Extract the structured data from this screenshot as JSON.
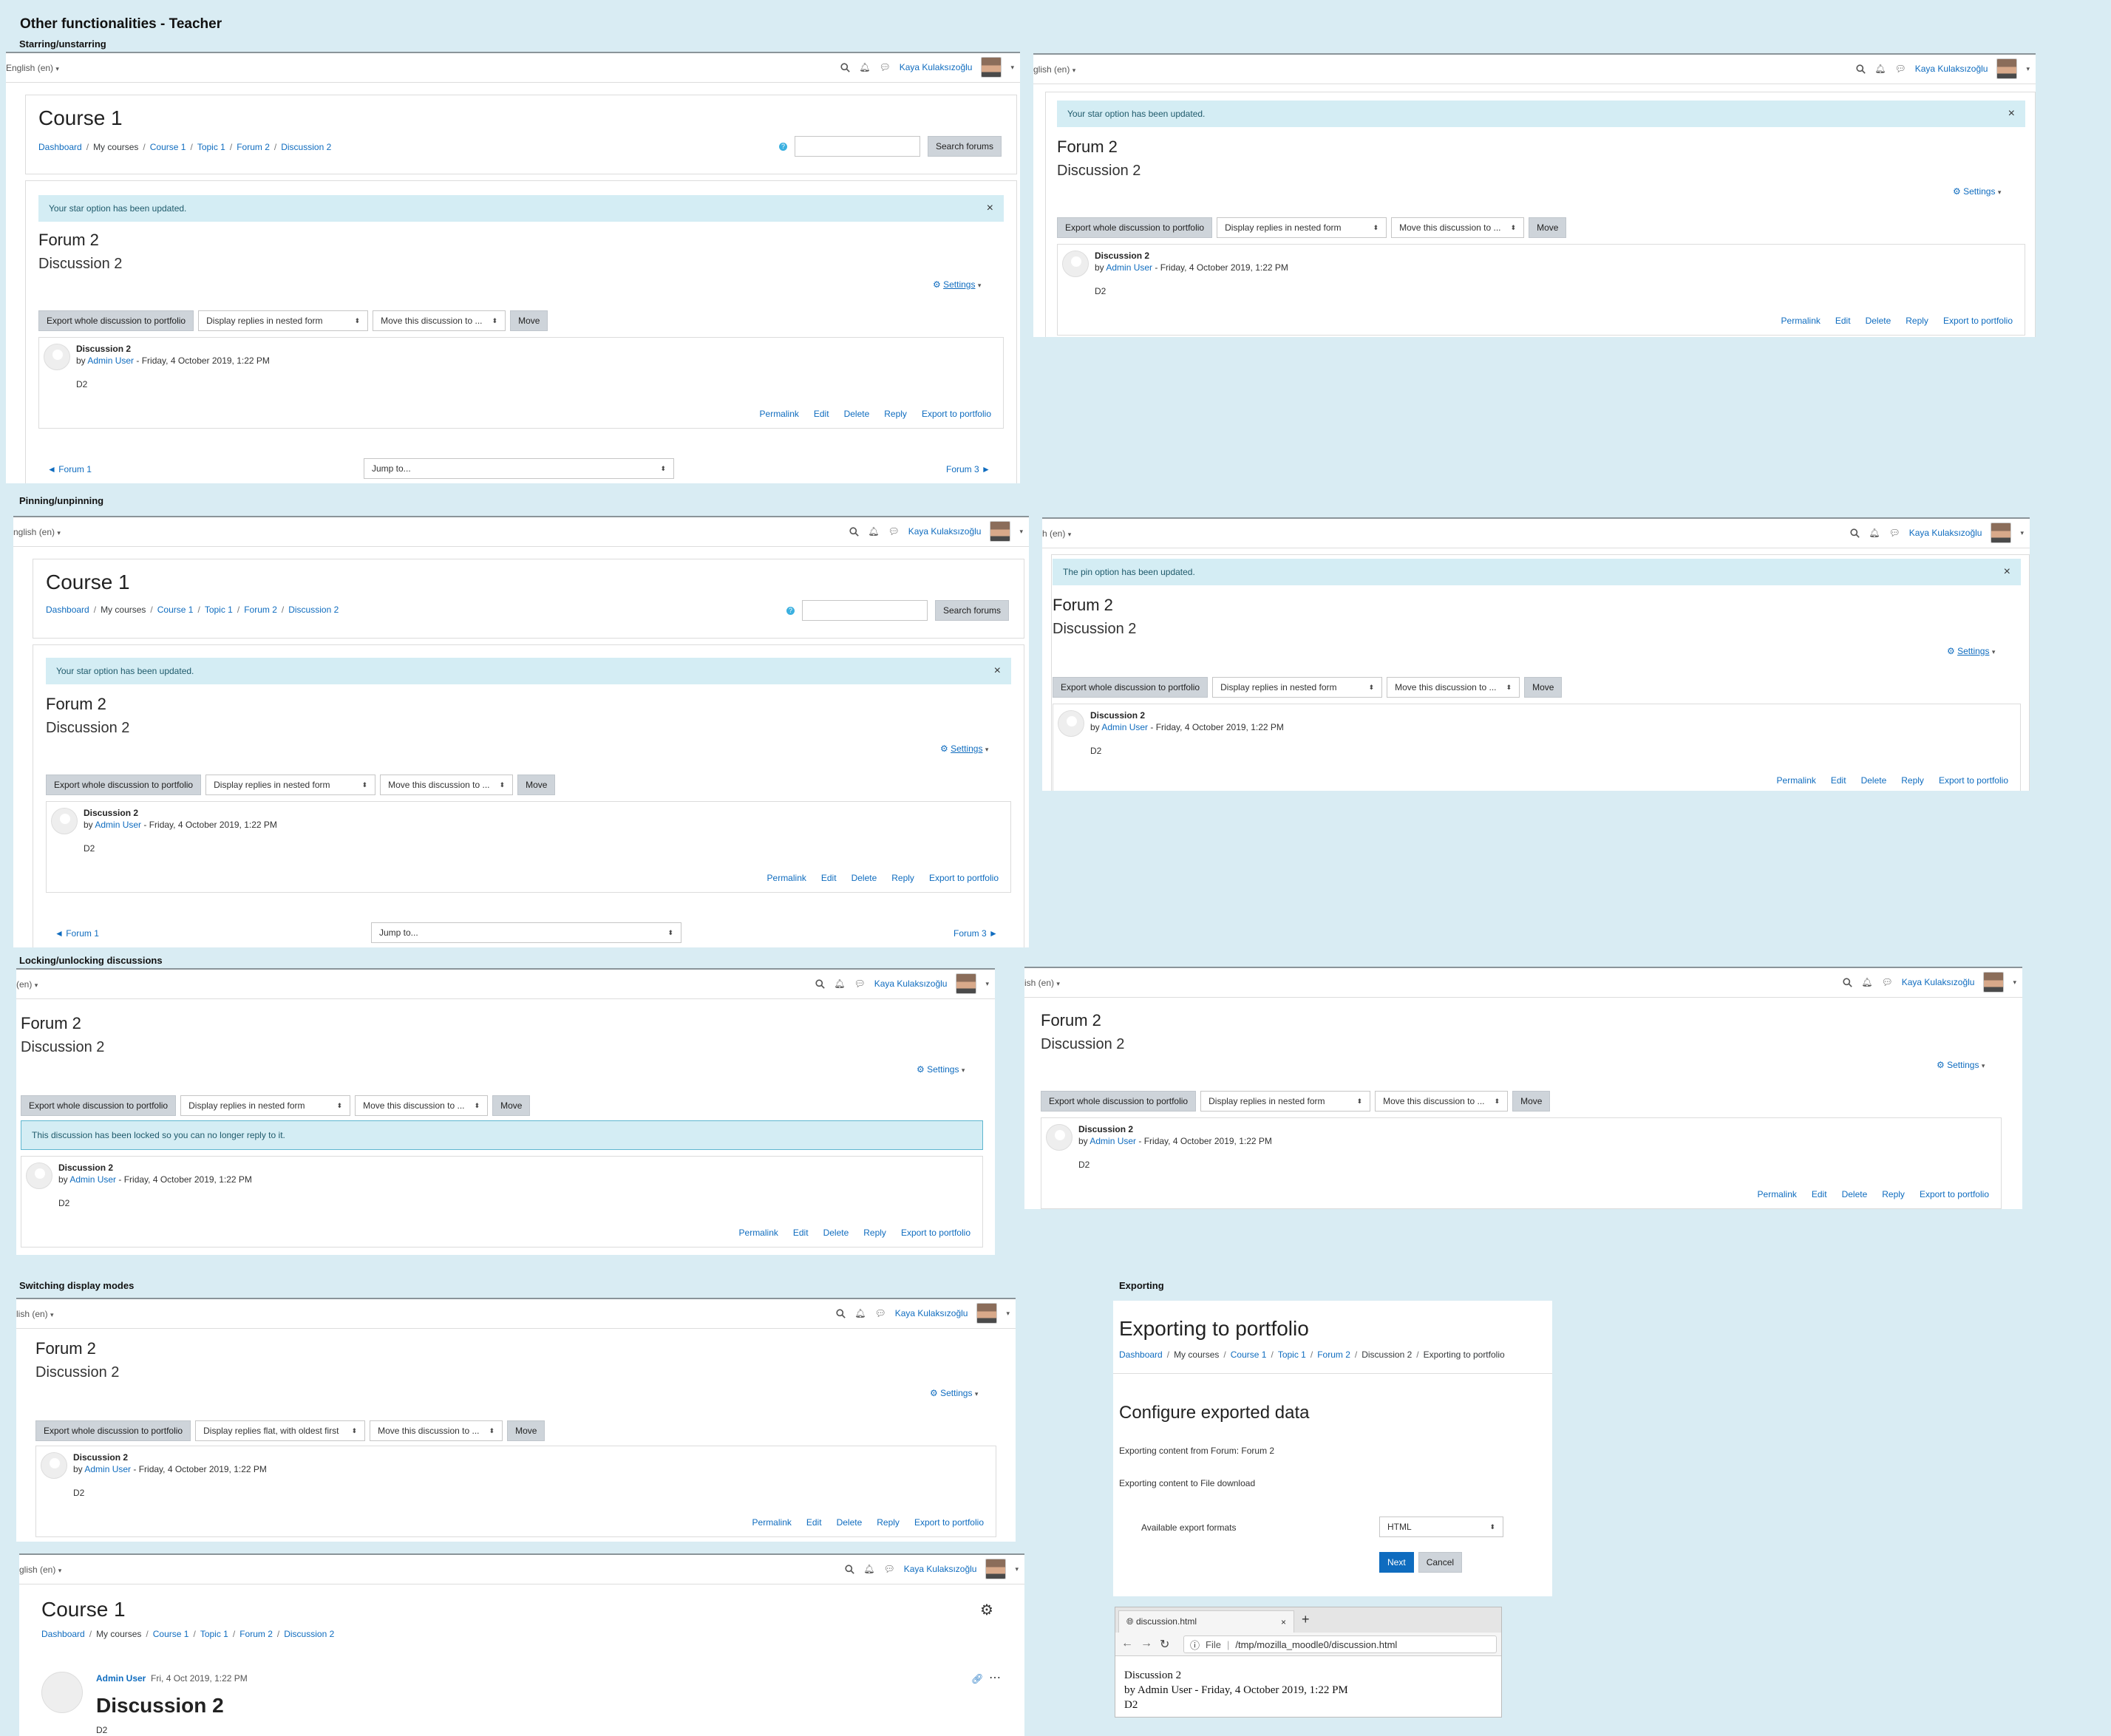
{
  "title": "Other functionalities - Teacher",
  "sections": {
    "starring": "Starring/unstarring",
    "pinning": "Pinning/unpinning",
    "locking": "Locking/unlocking discussions",
    "display": "Switching display modes",
    "exporting": "Exporting"
  },
  "nav": {
    "lang_full": "English (en)",
    "lang_a": "English (en)",
    "lang_b": "glish (en)",
    "lang_c": "nglish (en)",
    "lang_d": "h (en)",
    "lang_e": "(en)",
    "lang_f": "ish (en)",
    "lang_g": "lish (en)",
    "lang_h": "glish (en)",
    "user": "Kaya Kulaksızoğlu"
  },
  "course": {
    "title": "Course 1",
    "breadcrumbs": [
      "Dashboard",
      "My courses",
      "Course 1",
      "Topic 1",
      "Forum 2",
      "Discussion 2"
    ],
    "search_button": "Search forums"
  },
  "alerts": {
    "star": "Your star option has been updated.",
    "pin": "The pin option has been updated.",
    "locked": "This discussion has been locked so you can no longer reply to it.",
    "close": "×"
  },
  "forum": {
    "name": "Forum 2",
    "discussion": "Discussion 2",
    "settings": "Settings",
    "export_btn": "Export whole discussion to portfolio",
    "display_nested": "Display replies in nested form",
    "display_flat": "Display replies flat, with oldest first",
    "move_select": "Move this discussion to ...",
    "move_btn": "Move"
  },
  "post": {
    "subject": "Discussion 2",
    "by": "by",
    "author": "Admin User",
    "date": "- Friday, 4 October 2019, 1:22 PM",
    "body": "D2",
    "commands": [
      "Permalink",
      "Edit",
      "Delete",
      "Reply",
      "Export to portfolio"
    ]
  },
  "pager": {
    "prev": "◄ Forum 1",
    "jump": "Jump to...",
    "next": "Forum 3 ►"
  },
  "new_ui": {
    "author": "Admin User",
    "date": "Fri, 4 Oct 2019, 1:22 PM",
    "title": "Discussion 2",
    "body": "D2"
  },
  "export": {
    "title": "Exporting to portfolio",
    "breadcrumbs": [
      "Dashboard",
      "My courses",
      "Course 1",
      "Topic 1",
      "Forum 2",
      "Discussion 2",
      "Exporting to portfolio"
    ],
    "heading": "Configure exported data",
    "line1": "Exporting content from Forum: Forum 2",
    "line2": "Exporting content to File download",
    "formats_label": "Available export formats",
    "format_value": "HTML",
    "next": "Next",
    "cancel": "Cancel"
  },
  "browser": {
    "tab": "discussion.html",
    "close": "×",
    "new_tab": "+",
    "file_label": "File",
    "url": "/tmp/mozilla_moodle0/discussion.html",
    "line1": "Discussion 2",
    "line2": "by Admin User - Friday, 4 October 2019, 1:22 PM",
    "line3": "D2"
  },
  "colors": {
    "link": "#0f6cbf",
    "background": "#d9ecf3",
    "next_button": "#0f6cbf"
  }
}
